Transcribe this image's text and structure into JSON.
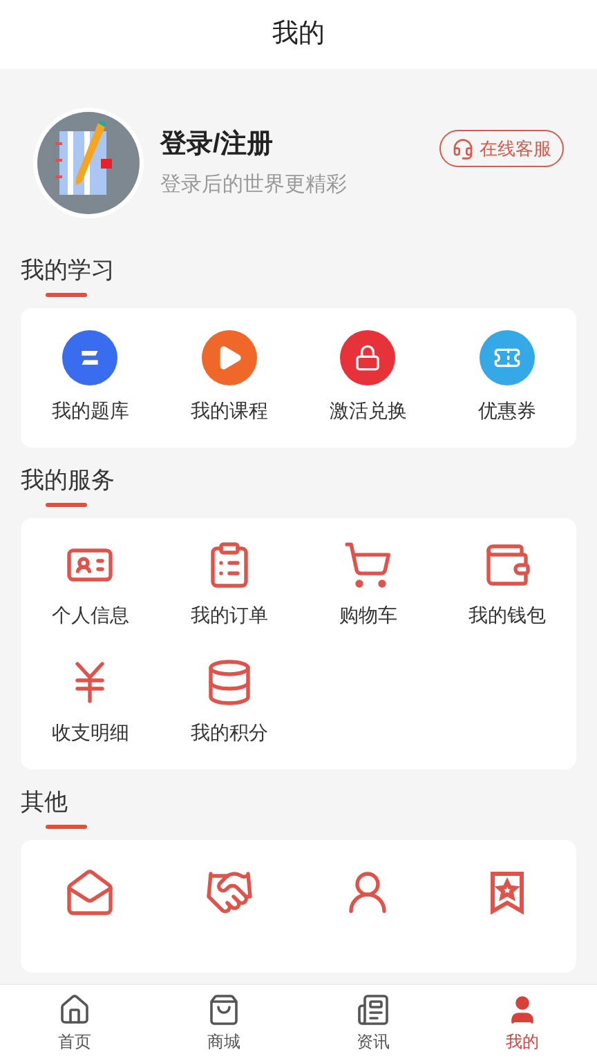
{
  "header": {
    "title": "我的"
  },
  "profile": {
    "name": "登录/注册",
    "subtitle": "登录后的世界更精彩",
    "service_button": "在线客服"
  },
  "sections": [
    {
      "title": "我的学习",
      "kind": "colored",
      "items": [
        {
          "label": "我的题库",
          "color": "#3a6cf0"
        },
        {
          "label": "我的课程",
          "color": "#f0672a"
        },
        {
          "label": "激活兑换",
          "color": "#e8323a"
        },
        {
          "label": "优惠券",
          "color": "#35a8e6"
        }
      ]
    },
    {
      "title": "我的服务",
      "kind": "outline",
      "items": [
        {
          "label": "个人信息"
        },
        {
          "label": "我的订单"
        },
        {
          "label": "购物车"
        },
        {
          "label": "我的钱包"
        },
        {
          "label": "收支明细"
        },
        {
          "label": "我的积分"
        }
      ]
    },
    {
      "title": "其他",
      "kind": "outline_cut",
      "items": [
        {
          "kind": "envelope"
        },
        {
          "kind": "handshake"
        },
        {
          "kind": "user"
        },
        {
          "kind": "star"
        }
      ]
    }
  ],
  "bottom_nav": [
    {
      "label": "首页",
      "selected": false
    },
    {
      "label": "商城",
      "selected": false
    },
    {
      "label": "资讯",
      "selected": false
    },
    {
      "label": "我的",
      "selected": true
    }
  ]
}
